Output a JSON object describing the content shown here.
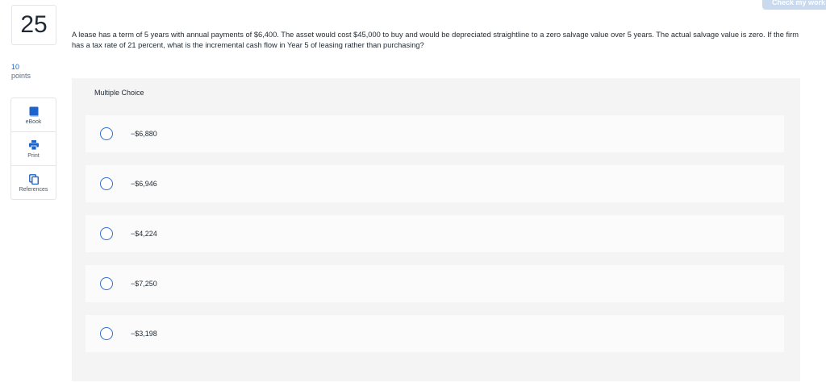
{
  "question": {
    "number": "25",
    "points_value": "10",
    "points_label": "points",
    "text": "A lease has a term of 5 years with annual payments of $6,400. The asset would cost $45,000 to buy and would be depreciated straightline to a zero salvage value over 5 years. The actual salvage value is zero. If the firm has a tax rate of 21 percent, what is the incremental cash flow in Year 5 of leasing rather than purchasing?"
  },
  "tools": [
    {
      "label": "eBook",
      "icon": "book-icon"
    },
    {
      "label": "Print",
      "icon": "printer-icon"
    },
    {
      "label": "References",
      "icon": "references-icon"
    }
  ],
  "check_button": "Check my work",
  "multiple_choice": {
    "header": "Multiple Choice",
    "options": [
      "−$6,880",
      "−$6,946",
      "−$4,224",
      "−$7,250",
      "−$3,198"
    ]
  },
  "colors": {
    "accent": "#2f6fcf",
    "points": "#1d63c9",
    "panel": "#f4f4f5",
    "check_button": "#c9d9ee"
  }
}
